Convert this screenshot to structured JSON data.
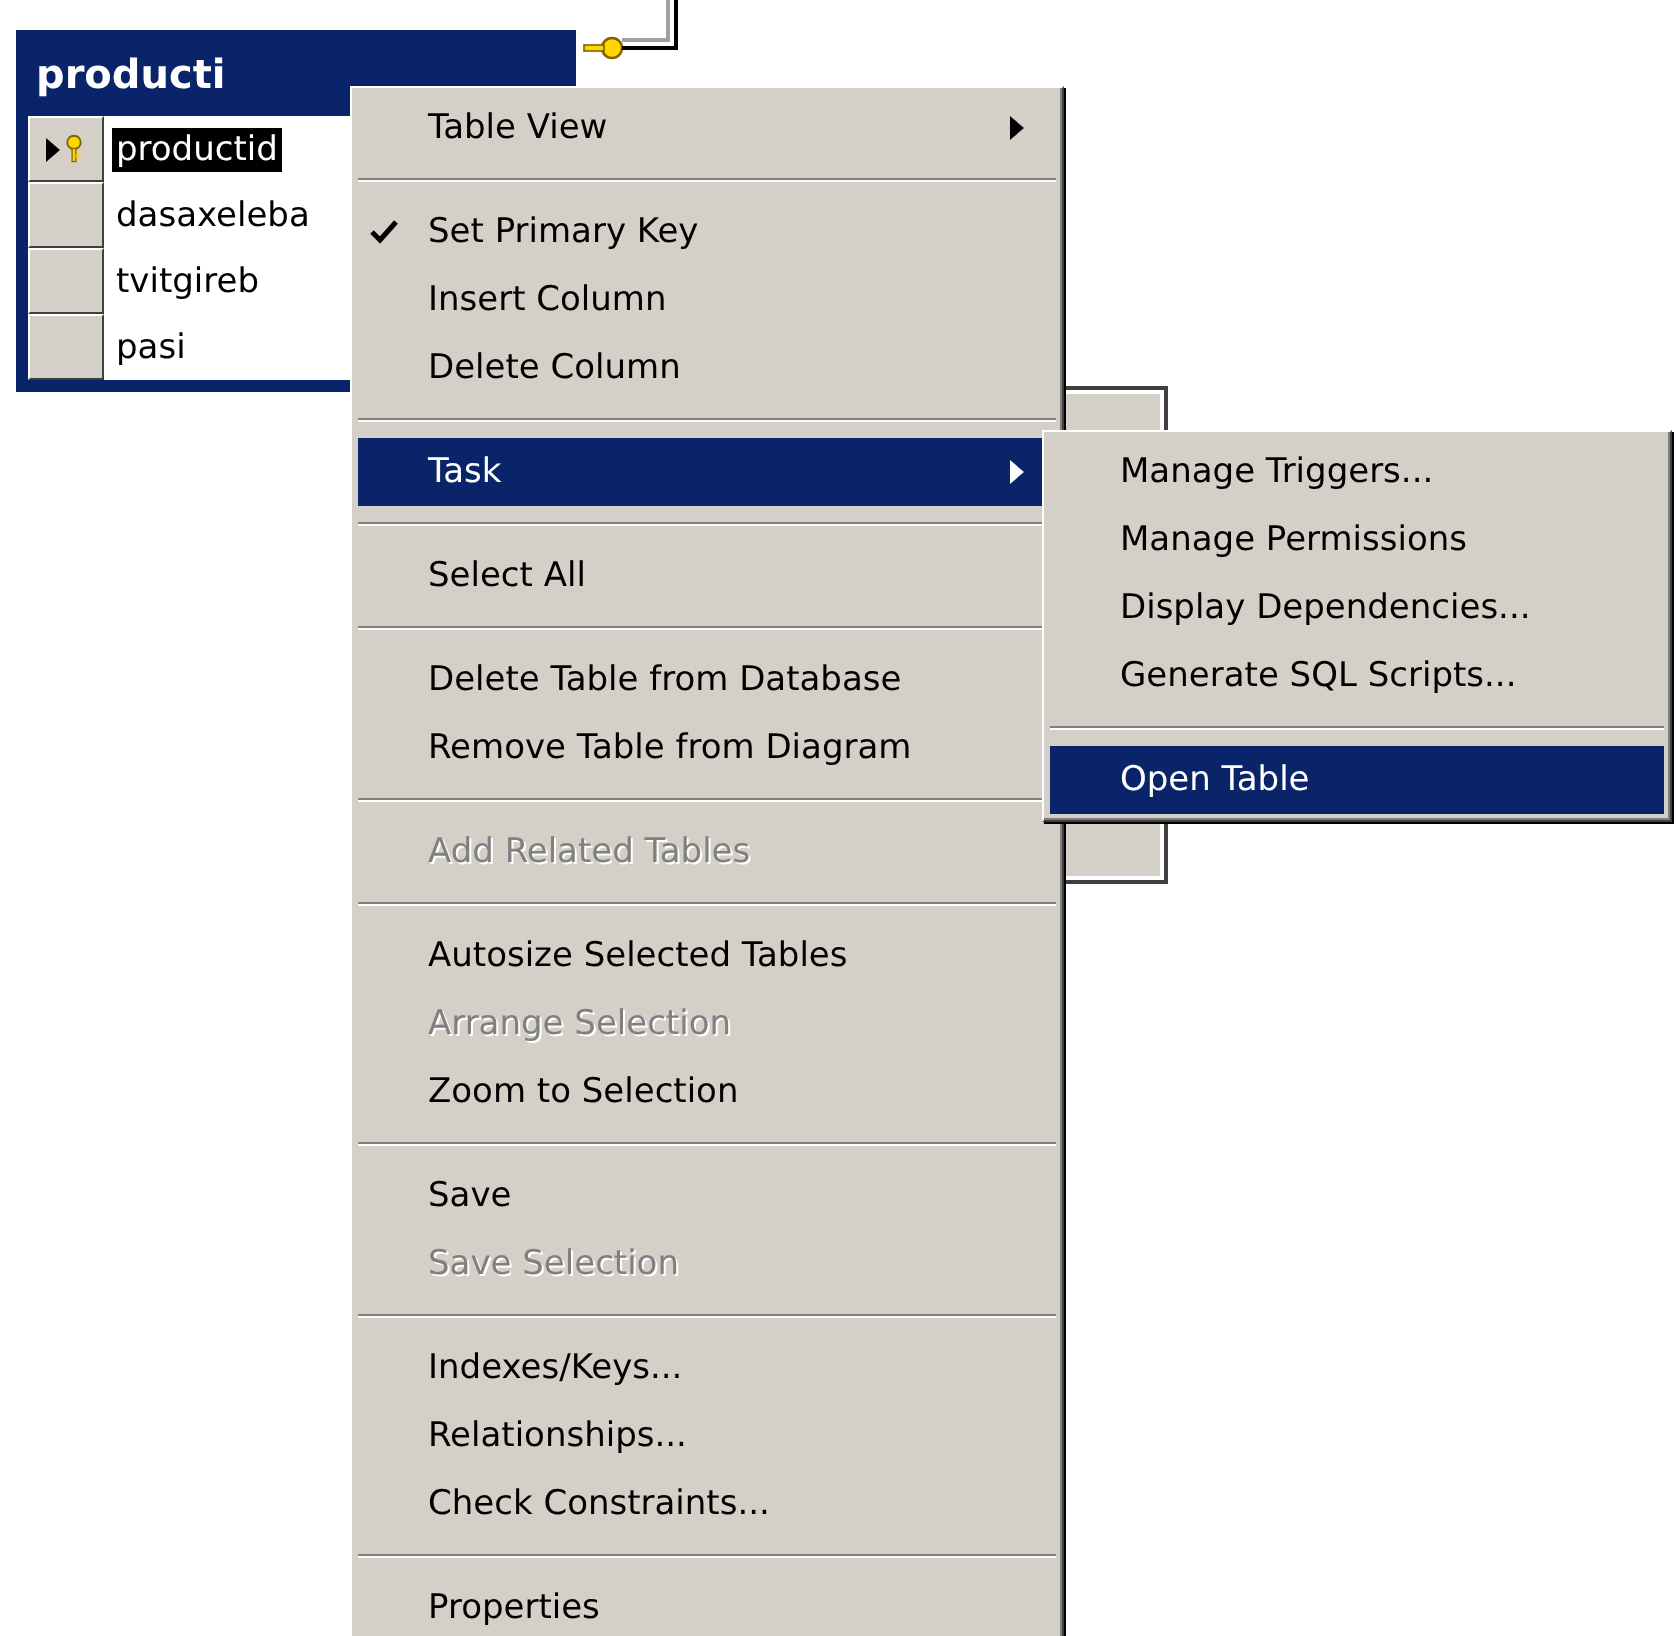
{
  "diagram_table": {
    "title": "producti",
    "columns": [
      {
        "name": "productid",
        "primary_key": true,
        "selected": true
      },
      {
        "name": "dasaxeleba",
        "primary_key": false,
        "selected": false
      },
      {
        "name": "tvitgireb",
        "primary_key": false,
        "selected": false
      },
      {
        "name": "pasi",
        "primary_key": false,
        "selected": false
      }
    ]
  },
  "context_menu": {
    "items": [
      {
        "kind": "item",
        "label": "Table View",
        "submenu": true,
        "highlighted": false,
        "disabled": false,
        "checked": false
      },
      {
        "kind": "separator"
      },
      {
        "kind": "item",
        "label": "Set Primary Key",
        "submenu": false,
        "highlighted": false,
        "disabled": false,
        "checked": true
      },
      {
        "kind": "item",
        "label": "Insert Column",
        "submenu": false,
        "highlighted": false,
        "disabled": false,
        "checked": false
      },
      {
        "kind": "item",
        "label": "Delete Column",
        "submenu": false,
        "highlighted": false,
        "disabled": false,
        "checked": false
      },
      {
        "kind": "separator"
      },
      {
        "kind": "item",
        "label": "Task",
        "submenu": true,
        "highlighted": true,
        "disabled": false,
        "checked": false
      },
      {
        "kind": "separator"
      },
      {
        "kind": "item",
        "label": "Select All",
        "submenu": false,
        "highlighted": false,
        "disabled": false,
        "checked": false
      },
      {
        "kind": "separator"
      },
      {
        "kind": "item",
        "label": "Delete Table from Database",
        "submenu": false,
        "highlighted": false,
        "disabled": false,
        "checked": false
      },
      {
        "kind": "item",
        "label": "Remove Table from Diagram",
        "submenu": false,
        "highlighted": false,
        "disabled": false,
        "checked": false
      },
      {
        "kind": "separator"
      },
      {
        "kind": "item",
        "label": "Add Related Tables",
        "submenu": false,
        "highlighted": false,
        "disabled": true,
        "checked": false
      },
      {
        "kind": "separator"
      },
      {
        "kind": "item",
        "label": "Autosize Selected Tables",
        "submenu": false,
        "highlighted": false,
        "disabled": false,
        "checked": false
      },
      {
        "kind": "item",
        "label": "Arrange Selection",
        "submenu": false,
        "highlighted": false,
        "disabled": true,
        "checked": false
      },
      {
        "kind": "item",
        "label": "Zoom to Selection",
        "submenu": false,
        "highlighted": false,
        "disabled": false,
        "checked": false
      },
      {
        "kind": "separator"
      },
      {
        "kind": "item",
        "label": "Save",
        "submenu": false,
        "highlighted": false,
        "disabled": false,
        "checked": false
      },
      {
        "kind": "item",
        "label": "Save Selection",
        "submenu": false,
        "highlighted": false,
        "disabled": true,
        "checked": false
      },
      {
        "kind": "separator"
      },
      {
        "kind": "item",
        "label": "Indexes/Keys...",
        "submenu": false,
        "highlighted": false,
        "disabled": false,
        "checked": false
      },
      {
        "kind": "item",
        "label": "Relationships...",
        "submenu": false,
        "highlighted": false,
        "disabled": false,
        "checked": false
      },
      {
        "kind": "item",
        "label": "Check Constraints...",
        "submenu": false,
        "highlighted": false,
        "disabled": false,
        "checked": false
      },
      {
        "kind": "separator"
      },
      {
        "kind": "item",
        "label": "Properties",
        "submenu": false,
        "highlighted": false,
        "disabled": false,
        "checked": false
      }
    ]
  },
  "task_submenu": {
    "items": [
      {
        "kind": "item",
        "label": "Manage Triggers...",
        "highlighted": false
      },
      {
        "kind": "item",
        "label": "Manage Permissions",
        "highlighted": false
      },
      {
        "kind": "item",
        "label": "Display Dependencies...",
        "highlighted": false
      },
      {
        "kind": "item",
        "label": "Generate SQL Scripts...",
        "highlighted": false
      },
      {
        "kind": "separator"
      },
      {
        "kind": "item",
        "label": "Open Table",
        "highlighted": true
      }
    ]
  }
}
